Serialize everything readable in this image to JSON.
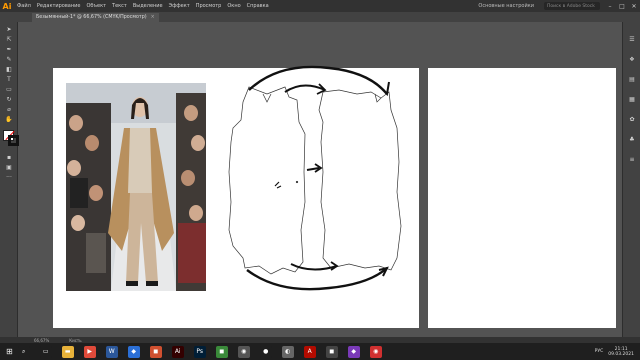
{
  "app": {
    "logo": "Ai"
  },
  "menu": [
    "Файл",
    "Редактирование",
    "Объект",
    "Текст",
    "Выделение",
    "Эффект",
    "Просмотр",
    "Окно",
    "Справка"
  ],
  "workspace": "Основные настройки",
  "search_placeholder": "Поиск в Adobe Stock",
  "window_controls": [
    "–",
    "□",
    "✕"
  ],
  "document_tab": {
    "title": "Безымянный-1* @ 66,67% (CMYK/Просмотр)",
    "close": "×"
  },
  "status": {
    "zoom": "66,67%",
    "tool": "Кисть"
  },
  "taskbar": {
    "apps": [
      {
        "icon": "search-icon",
        "color": "#1f1f1f",
        "glyph": "⌕"
      },
      {
        "icon": "task-view-icon",
        "color": "#1f1f1f",
        "glyph": "▭"
      },
      {
        "icon": "explorer-icon",
        "color": "#e8b23a",
        "glyph": "▬"
      },
      {
        "icon": "media-icon",
        "color": "#e04a3a",
        "glyph": "▶"
      },
      {
        "icon": "word-icon",
        "color": "#2b579a",
        "glyph": "W"
      },
      {
        "icon": "app-icon",
        "color": "#2b6fd6",
        "glyph": "◆"
      },
      {
        "icon": "app-icon",
        "color": "#d05030",
        "glyph": "◼"
      },
      {
        "icon": "illustrator-icon",
        "color": "#330000",
        "glyph": "Ai"
      },
      {
        "icon": "photoshop-icon",
        "color": "#001e36",
        "glyph": "Ps"
      },
      {
        "icon": "app-icon",
        "color": "#3a8a3a",
        "glyph": "◼"
      },
      {
        "icon": "app-icon",
        "color": "#555555",
        "glyph": "◉"
      },
      {
        "icon": "chrome-icon",
        "color": "#1f1f1f",
        "glyph": "●"
      },
      {
        "icon": "app-icon",
        "color": "#666666",
        "glyph": "◐"
      },
      {
        "icon": "pdf-icon",
        "color": "#b30b00",
        "glyph": "A"
      },
      {
        "icon": "app-icon",
        "color": "#444444",
        "glyph": "◼"
      },
      {
        "icon": "app-icon",
        "color": "#7a3ab8",
        "glyph": "◆"
      },
      {
        "icon": "app-icon",
        "color": "#d03030",
        "glyph": "◉"
      }
    ],
    "language": "РУС",
    "time": "21:11",
    "date": "09.03.2021"
  },
  "colors": {
    "accent": "#ff9a00",
    "pasteboard": "#535353",
    "artboard": "#ffffff"
  }
}
